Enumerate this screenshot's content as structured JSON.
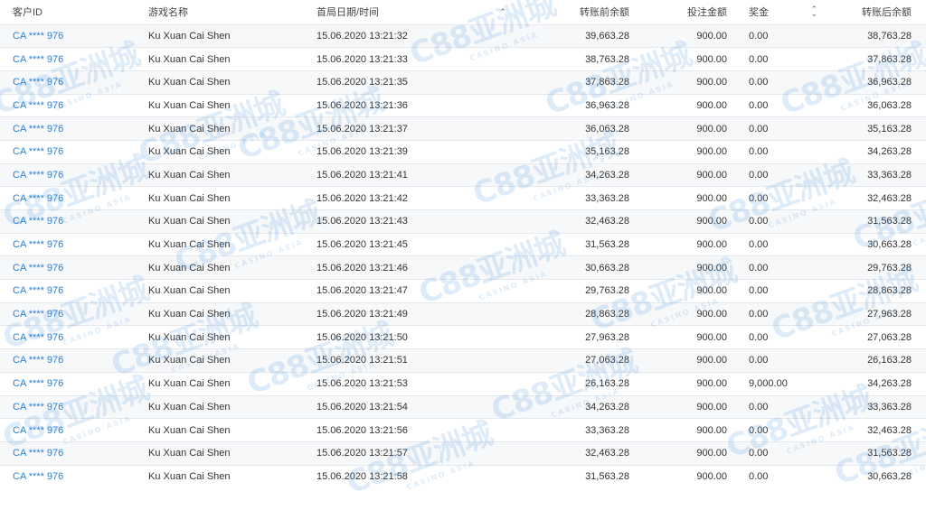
{
  "headers": {
    "customer_id": "客户ID",
    "game_name": "游戏名称",
    "first_round_datetime": "首局日期/时间",
    "balance_before": "转账前余额",
    "bet_amount": "投注金额",
    "prize": "奖金",
    "balance_after": "转账后余额"
  },
  "watermark": {
    "logo": "C88亚洲城",
    "subtitle": "CASINO ASIA"
  },
  "rows": [
    {
      "id": "CA **** 976",
      "game": "Ku Xuan Cai Shen",
      "datetime": "15.06.2020 13:21:32",
      "before": "39,663.28",
      "bet": "900.00",
      "prize": "0.00",
      "after": "38,763.28"
    },
    {
      "id": "CA **** 976",
      "game": "Ku Xuan Cai Shen",
      "datetime": "15.06.2020 13:21:33",
      "before": "38,763.28",
      "bet": "900.00",
      "prize": "0.00",
      "after": "37,863.28"
    },
    {
      "id": "CA **** 976",
      "game": "Ku Xuan Cai Shen",
      "datetime": "15.06.2020 13:21:35",
      "before": "37,863.28",
      "bet": "900.00",
      "prize": "0.00",
      "after": "36,963.28"
    },
    {
      "id": "CA **** 976",
      "game": "Ku Xuan Cai Shen",
      "datetime": "15.06.2020 13:21:36",
      "before": "36,963.28",
      "bet": "900.00",
      "prize": "0.00",
      "after": "36,063.28"
    },
    {
      "id": "CA **** 976",
      "game": "Ku Xuan Cai Shen",
      "datetime": "15.06.2020 13:21:37",
      "before": "36,063.28",
      "bet": "900.00",
      "prize": "0.00",
      "after": "35,163.28"
    },
    {
      "id": "CA **** 976",
      "game": "Ku Xuan Cai Shen",
      "datetime": "15.06.2020 13:21:39",
      "before": "35,163.28",
      "bet": "900.00",
      "prize": "0.00",
      "after": "34,263.28"
    },
    {
      "id": "CA **** 976",
      "game": "Ku Xuan Cai Shen",
      "datetime": "15.06.2020 13:21:41",
      "before": "34,263.28",
      "bet": "900.00",
      "prize": "0.00",
      "after": "33,363.28"
    },
    {
      "id": "CA **** 976",
      "game": "Ku Xuan Cai Shen",
      "datetime": "15.06.2020 13:21:42",
      "before": "33,363.28",
      "bet": "900.00",
      "prize": "0.00",
      "after": "32,463.28"
    },
    {
      "id": "CA **** 976",
      "game": "Ku Xuan Cai Shen",
      "datetime": "15.06.2020 13:21:43",
      "before": "32,463.28",
      "bet": "900.00",
      "prize": "0.00",
      "after": "31,563.28"
    },
    {
      "id": "CA **** 976",
      "game": "Ku Xuan Cai Shen",
      "datetime": "15.06.2020 13:21:45",
      "before": "31,563.28",
      "bet": "900.00",
      "prize": "0.00",
      "after": "30,663.28"
    },
    {
      "id": "CA **** 976",
      "game": "Ku Xuan Cai Shen",
      "datetime": "15.06.2020 13:21:46",
      "before": "30,663.28",
      "bet": "900.00",
      "prize": "0.00",
      "after": "29,763.28"
    },
    {
      "id": "CA **** 976",
      "game": "Ku Xuan Cai Shen",
      "datetime": "15.06.2020 13:21:47",
      "before": "29,763.28",
      "bet": "900.00",
      "prize": "0.00",
      "after": "28,863.28"
    },
    {
      "id": "CA **** 976",
      "game": "Ku Xuan Cai Shen",
      "datetime": "15.06.2020 13:21:49",
      "before": "28,863.28",
      "bet": "900.00",
      "prize": "0.00",
      "after": "27,963.28"
    },
    {
      "id": "CA **** 976",
      "game": "Ku Xuan Cai Shen",
      "datetime": "15.06.2020 13:21:50",
      "before": "27,963.28",
      "bet": "900.00",
      "prize": "0.00",
      "after": "27,063.28"
    },
    {
      "id": "CA **** 976",
      "game": "Ku Xuan Cai Shen",
      "datetime": "15.06.2020 13:21:51",
      "before": "27,063.28",
      "bet": "900.00",
      "prize": "0.00",
      "after": "26,163.28"
    },
    {
      "id": "CA **** 976",
      "game": "Ku Xuan Cai Shen",
      "datetime": "15.06.2020 13:21:53",
      "before": "26,163.28",
      "bet": "900.00",
      "prize": "9,000.00",
      "after": "34,263.28"
    },
    {
      "id": "CA **** 976",
      "game": "Ku Xuan Cai Shen",
      "datetime": "15.06.2020 13:21:54",
      "before": "34,263.28",
      "bet": "900.00",
      "prize": "0.00",
      "after": "33,363.28"
    },
    {
      "id": "CA **** 976",
      "game": "Ku Xuan Cai Shen",
      "datetime": "15.06.2020 13:21:56",
      "before": "33,363.28",
      "bet": "900.00",
      "prize": "0.00",
      "after": "32,463.28"
    },
    {
      "id": "CA **** 976",
      "game": "Ku Xuan Cai Shen",
      "datetime": "15.06.2020 13:21:57",
      "before": "32,463.28",
      "bet": "900.00",
      "prize": "0.00",
      "after": "31,563.28"
    },
    {
      "id": "CA **** 976",
      "game": "Ku Xuan Cai Shen",
      "datetime": "15.06.2020 13:21:58",
      "before": "31,563.28",
      "bet": "900.00",
      "prize": "0.00",
      "after": "30,663.28"
    }
  ]
}
